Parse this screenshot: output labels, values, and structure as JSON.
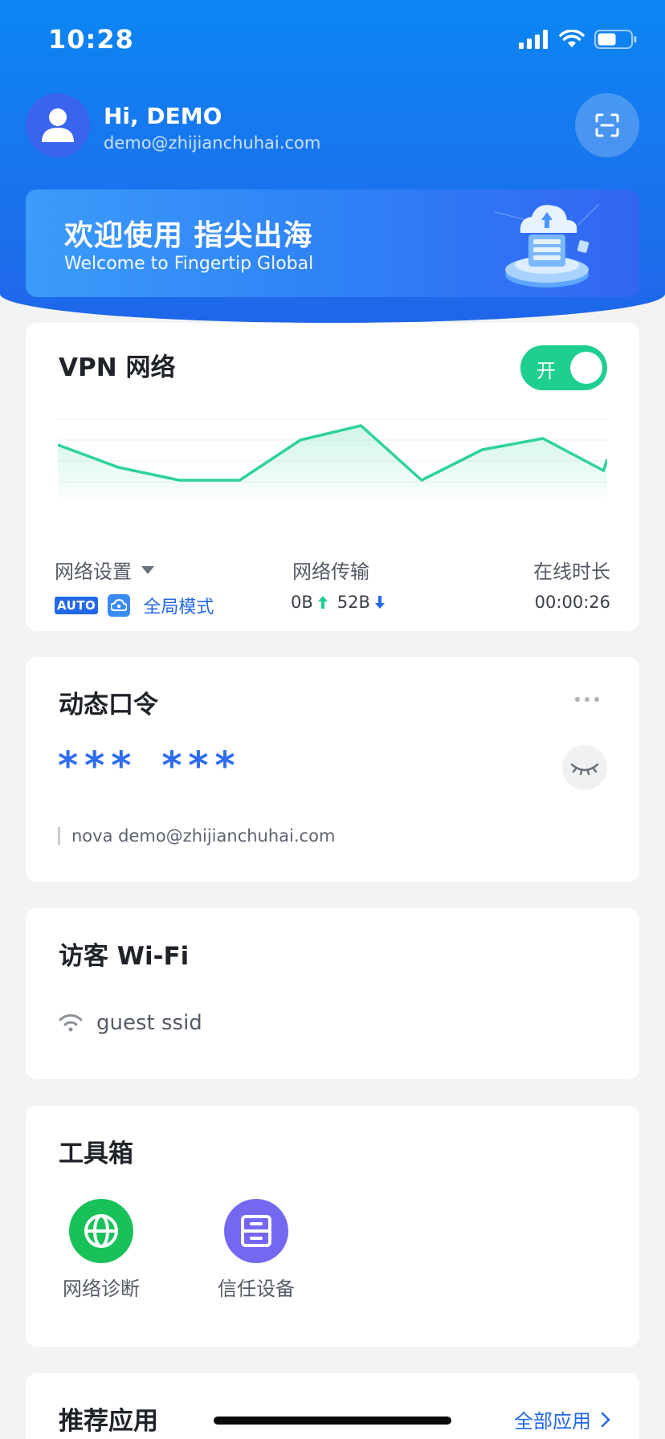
{
  "status_bar": {
    "time": "10:28",
    "icons": [
      "signal-icon",
      "wifi-icon",
      "battery-icon"
    ]
  },
  "profile": {
    "greeting": "Hi, DEMO",
    "email": "demo@zhijianchuhai.com"
  },
  "banner": {
    "title": "欢迎使用 指尖出海",
    "subtitle": "Welcome to Fingertip Global"
  },
  "vpn": {
    "title": "VPN 网络",
    "toggle_label": "开",
    "toggle_on": true,
    "stats": {
      "settings_label": "网络设置",
      "auto_badge": "AUTO",
      "mode": "全局模式",
      "transfer_label": "网络传输",
      "upload": "0B",
      "download": "52B",
      "online_label": "在线时长",
      "online_time": "00:00:26"
    }
  },
  "chart_data": {
    "type": "area",
    "x": [
      0,
      1,
      2,
      3,
      4,
      5,
      6,
      7,
      8,
      9
    ],
    "values": [
      0.66,
      0.38,
      0.22,
      0.22,
      0.72,
      0.9,
      0.22,
      0.6,
      0.74,
      0.34
    ],
    "values_end": 0.48,
    "color": "#2ed39a",
    "grid": true
  },
  "otp": {
    "title": "动态口令",
    "code_groups": [
      "***",
      "***"
    ],
    "account": "nova demo@zhijianchuhai.com"
  },
  "wifi": {
    "title": "访客 Wi-Fi",
    "ssid": "guest ssid"
  },
  "toolbox": {
    "title": "工具箱",
    "tools": [
      {
        "label": "网络诊断",
        "icon": "globe-icon",
        "color": "#19c15a"
      },
      {
        "label": "信任设备",
        "icon": "device-icon",
        "color": "#7468f0"
      }
    ]
  },
  "recommended": {
    "title": "推荐应用",
    "all_label": "全部应用"
  },
  "colors": {
    "accent": "#2468e8",
    "header": "#1a74ee",
    "toggle": "#1fcf8f"
  }
}
